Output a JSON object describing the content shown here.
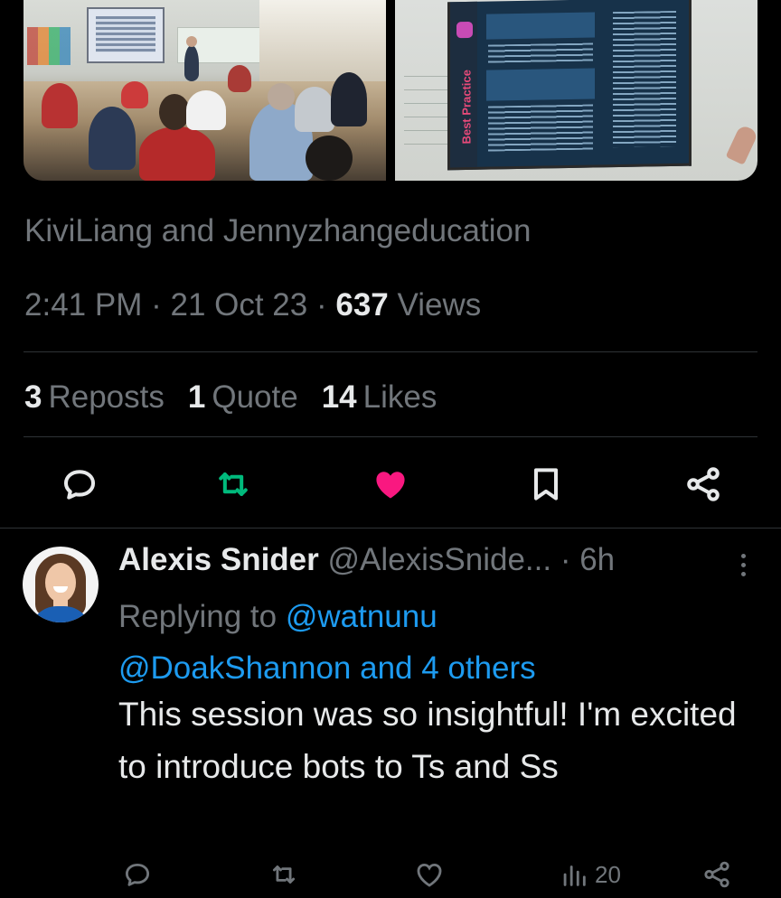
{
  "tweet": {
    "tagged_line": "KiviLiang and Jennyzhangeducation",
    "time": "2:41 PM",
    "date": "21 Oct 23",
    "views_count": "637",
    "views_label": "Views",
    "reposts_count": "3",
    "reposts_label": "Reposts",
    "quotes_count": "1",
    "quotes_label": "Quote",
    "likes_count": "14",
    "likes_label": "Likes",
    "media": {
      "slide_side_text": "Best Practice"
    },
    "actions": {
      "reply_icon": "reply-icon",
      "repost_icon": "repost-icon",
      "like_icon": "heart-icon",
      "bookmark_icon": "bookmark-icon",
      "share_icon": "share-icon"
    },
    "colors": {
      "repost_active": "#00ba7c",
      "like_active": "#f91880"
    }
  },
  "reply": {
    "display_name": "Alexis Snider",
    "handle": "@AlexisSnide...",
    "separator": "·",
    "time_ago": "6h",
    "replying_prefix": "Replying to",
    "replying_to_1": "@watnunu",
    "replying_to_2": "@DoakShannon and 4 others",
    "text": "This session was so insightful! I'm excited to introduce bots to Ts and Ss",
    "views_count": "20"
  },
  "colors": {
    "link": "#1d9bf0",
    "muted": "#71767b",
    "text": "#e7e9ea",
    "background": "#000000"
  }
}
